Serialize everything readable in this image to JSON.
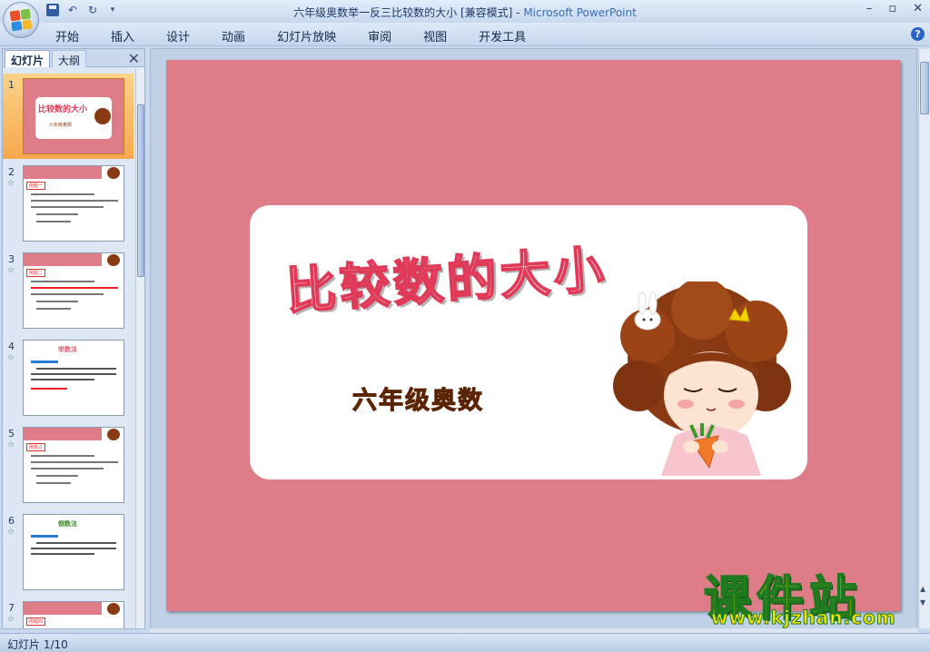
{
  "window": {
    "title_doc": "六年级奥数举一反三比较数的大小 [兼容模式]",
    "title_sep": " - ",
    "title_app": "Microsoft PowerPoint"
  },
  "ribbon": {
    "tabs": [
      "开始",
      "插入",
      "设计",
      "动画",
      "幻灯片放映",
      "审阅",
      "视图",
      "开发工具"
    ]
  },
  "panel": {
    "tab_slides": "幻灯片",
    "tab_outline": "大纲",
    "slides": [
      {
        "num": "1",
        "label": "比较数的大小",
        "sub": "六年级奥数"
      },
      {
        "num": "2",
        "label": "例题一"
      },
      {
        "num": "3",
        "label": "例题二"
      },
      {
        "num": "4",
        "label": "举数法"
      },
      {
        "num": "5",
        "label": "例题三"
      },
      {
        "num": "6",
        "label": "倒数法"
      },
      {
        "num": "7",
        "label": "例题四"
      }
    ]
  },
  "slide": {
    "title": "比较数的大小",
    "subtitle": "六年级奥数"
  },
  "watermark": {
    "brand": "课件站",
    "url": "www.kjzhan.com"
  },
  "status": {
    "slide_counter": "幻灯片 1/10"
  },
  "colors": {
    "slide_bg": "#de7c87",
    "title_stroke": "#e03a59",
    "subtitle": "#8a3c0a",
    "watermark_yellow": "#f5e600",
    "selection_orange": "#f6a94b"
  }
}
